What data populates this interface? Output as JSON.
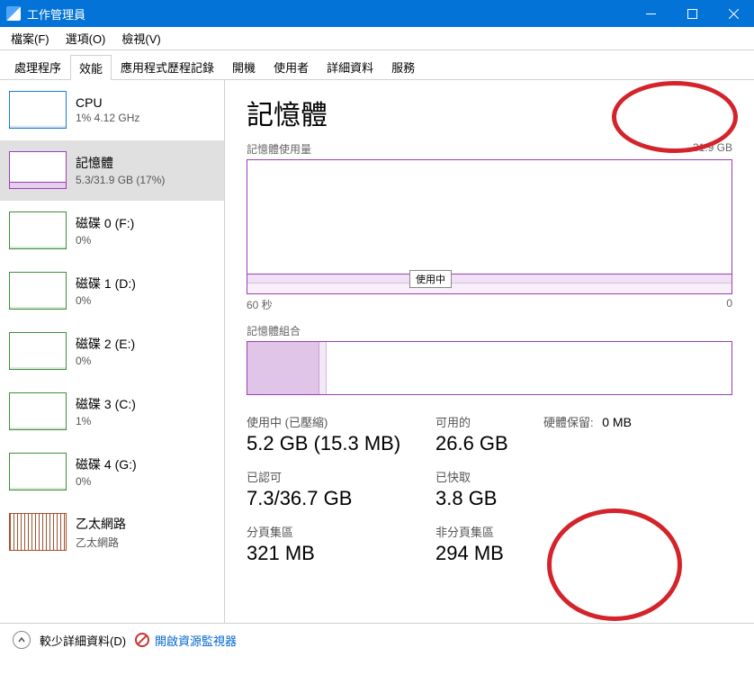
{
  "window": {
    "title": "工作管理員"
  },
  "menu": {
    "file": "檔案(F)",
    "options": "選項(O)",
    "view": "檢視(V)"
  },
  "tabs": {
    "processes": "處理程序",
    "performance": "效能",
    "apphistory": "應用程式歷程記錄",
    "startup": "開機",
    "users": "使用者",
    "details": "詳細資料",
    "services": "服務"
  },
  "sidebar": {
    "cpu": {
      "label": "CPU",
      "sub": "1% 4.12 GHz"
    },
    "mem": {
      "label": "記憶體",
      "sub": "5.3/31.9 GB (17%)"
    },
    "disk0": {
      "label": "磁碟 0 (F:)",
      "sub": "0%"
    },
    "disk1": {
      "label": "磁碟 1 (D:)",
      "sub": "0%"
    },
    "disk2": {
      "label": "磁碟 2 (E:)",
      "sub": "0%"
    },
    "disk3": {
      "label": "磁碟 3 (C:)",
      "sub": "1%"
    },
    "disk4": {
      "label": "磁碟 4 (G:)",
      "sub": "0%"
    },
    "eth": {
      "label": "乙太網路",
      "sub": "乙太網路"
    }
  },
  "main": {
    "title": "記憶體",
    "chart_label": "記憶體使用量",
    "chart_max": "31.9 GB",
    "chart_tooltip": "使用中",
    "xaxis_left": "60 秒",
    "xaxis_right": "0",
    "comp_label": "記憶體組合",
    "stats": {
      "in_use_label": "使用中 (已壓縮)",
      "in_use": "5.2 GB (15.3 MB)",
      "avail_label": "可用的",
      "avail": "26.6 GB",
      "hw_label": "硬體保留:",
      "hw": "0 MB",
      "commit_label": "已認可",
      "commit": "7.3/36.7 GB",
      "cached_label": "已快取",
      "cached": "3.8 GB",
      "paged_label": "分頁集區",
      "paged": "321 MB",
      "nonpaged_label": "非分頁集區",
      "nonpaged": "294 MB"
    }
  },
  "footer": {
    "less": "較少詳細資料(D)",
    "resmon": "開啟資源監視器"
  },
  "chart_data": {
    "type": "area",
    "title": "記憶體使用量",
    "ylabel": "GB",
    "ylim": [
      0,
      31.9
    ],
    "xlabel": "秒",
    "xlim": [
      60,
      0
    ],
    "approx_usage_gb": 5.3,
    "note": "Usage line is approximately flat at ~5.3 GB across the 60-second window"
  }
}
